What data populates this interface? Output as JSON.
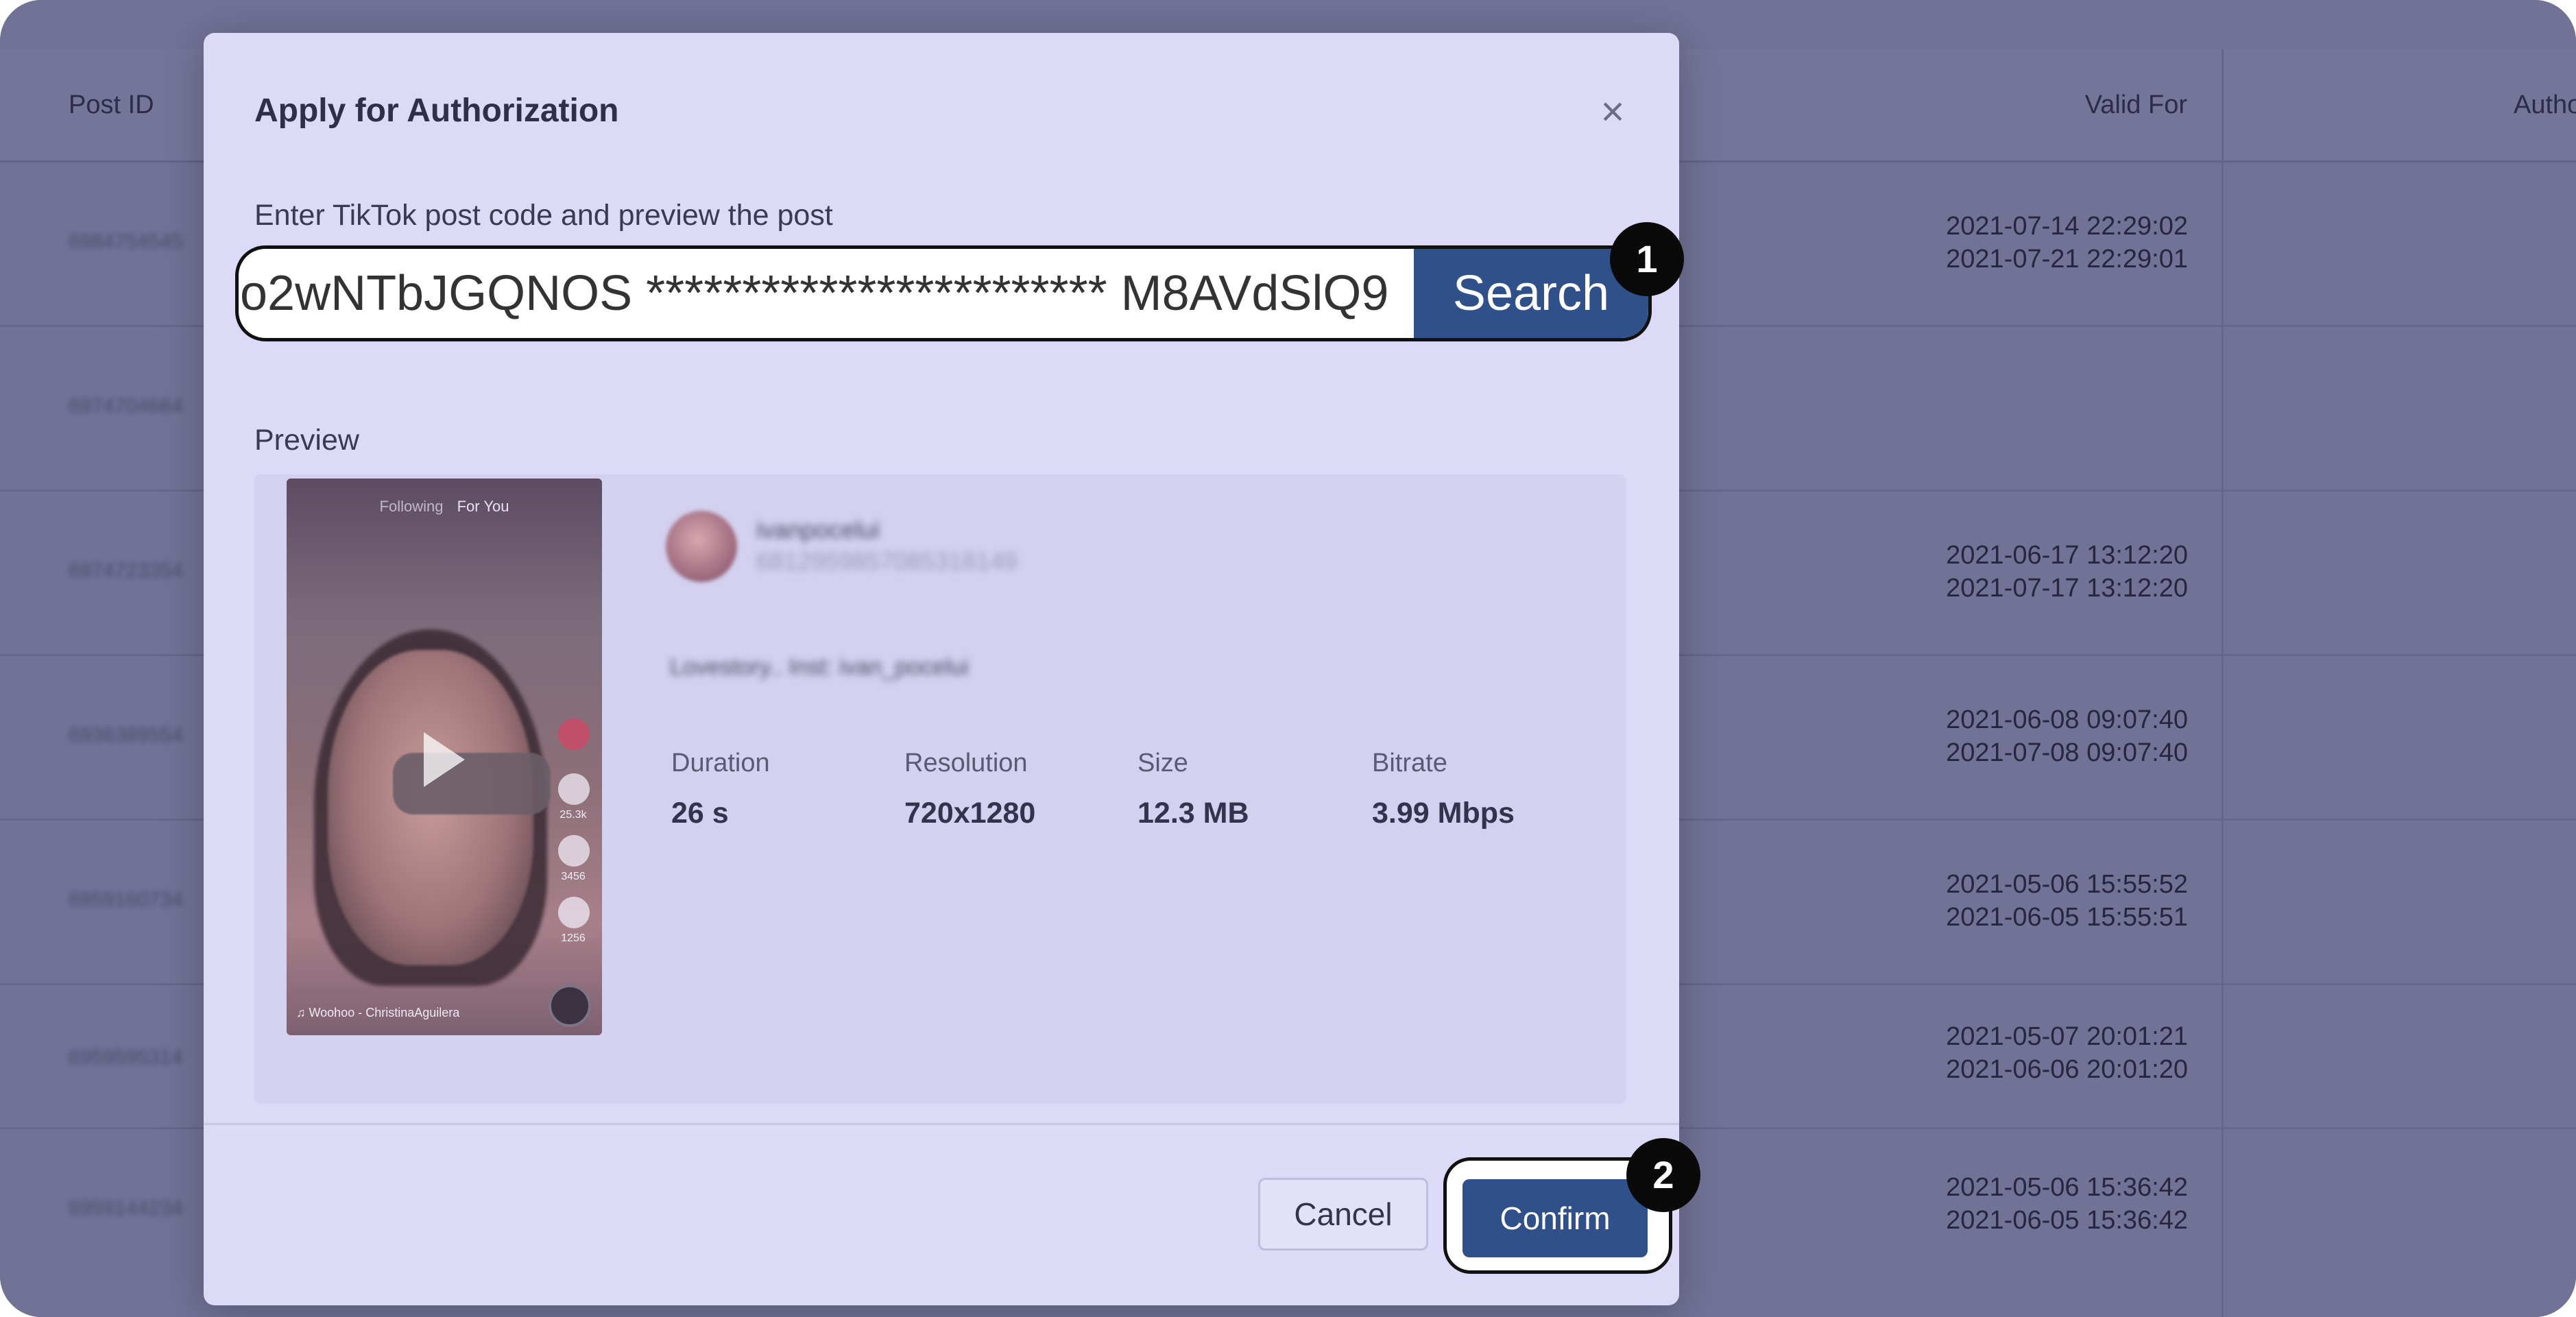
{
  "background_table": {
    "columns": [
      "Post ID",
      "Valid For",
      "Autho"
    ],
    "rows": [
      {
        "id": "6984754545",
        "valid_from": "2021-07-14 22:29:02",
        "valid_to": "2021-07-21 22:29:01"
      },
      {
        "id": "6974704664",
        "valid_from": "",
        "valid_to": ""
      },
      {
        "id": "6974723354",
        "valid_from": "2021-06-17 13:12:20",
        "valid_to": "2021-07-17 13:12:20"
      },
      {
        "id": "6936389554",
        "valid_from": "2021-06-08 09:07:40",
        "valid_to": "2021-07-08 09:07:40"
      },
      {
        "id": "6959160734",
        "valid_from": "2021-05-06 15:55:52",
        "valid_to": "2021-06-05 15:55:51"
      },
      {
        "id": "6959595314",
        "valid_from": "2021-05-07 20:01:21",
        "valid_to": "2021-06-06 20:01:20"
      },
      {
        "id": "6959144234",
        "valid_from": "2021-05-06 15:36:42",
        "valid_to": "2021-06-05 15:36:42"
      }
    ]
  },
  "modal": {
    "title": "Apply for Authorization",
    "close_icon": "×",
    "field_label": "Enter TikTok post code and preview the post",
    "search_value": "o2wNTbJGQNOS ************************ M8AVdSlQ9",
    "search_button": "Search",
    "preview_label": "Preview",
    "video": {
      "following": "Following",
      "for_you": "For You",
      "likes": "25.3k",
      "comments": "3456",
      "shares": "1256",
      "music": "♫ Woohoo - ChristinaAguilera"
    },
    "author": {
      "name": "ivanpocelui",
      "id": "6812959857085318149"
    },
    "caption": "Lovestory.. Inst: ivan_pocelui",
    "stats": [
      {
        "label": "Duration",
        "value": "26 s"
      },
      {
        "label": "Resolution",
        "value": "720x1280"
      },
      {
        "label": "Size",
        "value": "12.3 MB"
      },
      {
        "label": "Bitrate",
        "value": "3.99 Mbps"
      }
    ],
    "cancel_button": "Cancel",
    "confirm_button": "Confirm"
  },
  "annotations": {
    "step1": "1",
    "step2": "2"
  }
}
